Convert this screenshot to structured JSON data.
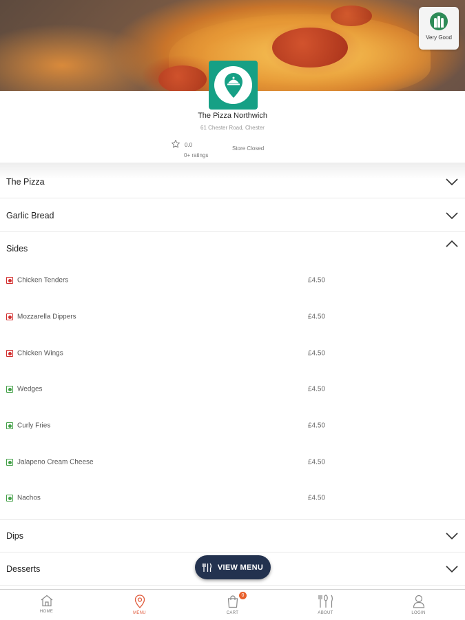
{
  "badge": {
    "label": "Very Good",
    "icon": "rating-bars-icon",
    "color": "#2e8b57"
  },
  "store": {
    "name": "The Pizza Northwich",
    "address": "61 Chester Road, Chester",
    "rating": "0.0",
    "ratings_count": "0+ ratings",
    "status": "Store Closed",
    "logo_icon": "map-pin-cloche-icon",
    "logo_color": "#16a085"
  },
  "categories": [
    {
      "label": "The Pizza",
      "expanded": false
    },
    {
      "label": "Garlic Bread",
      "expanded": false
    },
    {
      "label": "Sides",
      "expanded": true
    },
    {
      "label": "Dips",
      "expanded": false
    },
    {
      "label": "Desserts",
      "expanded": false
    }
  ],
  "sides_items": [
    {
      "name": "Chicken Tenders",
      "price": "£4.50",
      "type": "non-veg"
    },
    {
      "name": "Mozzarella Dippers",
      "price": "£4.50",
      "type": "non-veg"
    },
    {
      "name": "Chicken Wings",
      "price": "£4.50",
      "type": "non-veg"
    },
    {
      "name": "Wedges",
      "price": "£4.50",
      "type": "veg"
    },
    {
      "name": "Curly Fries",
      "price": "£4.50",
      "type": "veg"
    },
    {
      "name": "Jalapeno Cream Cheese",
      "price": "£4.50",
      "type": "veg"
    },
    {
      "name": "Nachos",
      "price": "£4.50",
      "type": "veg"
    }
  ],
  "view_menu": {
    "label": "VIEW MENU",
    "color": "#23324f"
  },
  "nav": [
    {
      "label": "HOME",
      "icon": "home-icon",
      "active": false
    },
    {
      "label": "MENU",
      "icon": "location-pin-icon",
      "active": true
    },
    {
      "label": "CART",
      "icon": "shopping-bag-icon",
      "active": false,
      "badge": "0"
    },
    {
      "label": "ABOUT",
      "icon": "cutlery-icon",
      "active": false
    },
    {
      "label": "LOGIN",
      "icon": "user-icon",
      "active": false
    }
  ],
  "colors": {
    "accent": "#e05a3a",
    "nonveg": "#d32f2f",
    "veg": "#43a047"
  }
}
